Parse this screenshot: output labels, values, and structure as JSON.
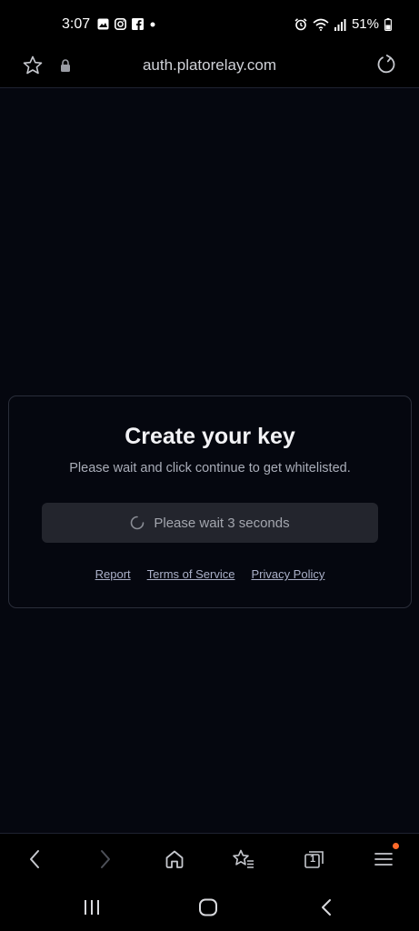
{
  "status_bar": {
    "time": "3:07",
    "battery": "51%",
    "left_icons": [
      "gallery-icon",
      "instagram-icon",
      "facebook-icon",
      "dot-icon"
    ],
    "right_icons": [
      "alarm-icon",
      "wifi-icon",
      "signal-icon",
      "battery-icon"
    ]
  },
  "browser": {
    "url": "auth.platorelay.com"
  },
  "card": {
    "title": "Create your key",
    "subtitle": "Please wait and click continue to get whitelisted.",
    "wait_button_label": "Please wait 3 seconds",
    "links": {
      "report": "Report",
      "terms": "Terms of Service",
      "privacy": "Privacy Policy"
    }
  },
  "bottom_nav": {
    "tab_count": "1",
    "menu_badge_color": "#ff6a2a"
  }
}
